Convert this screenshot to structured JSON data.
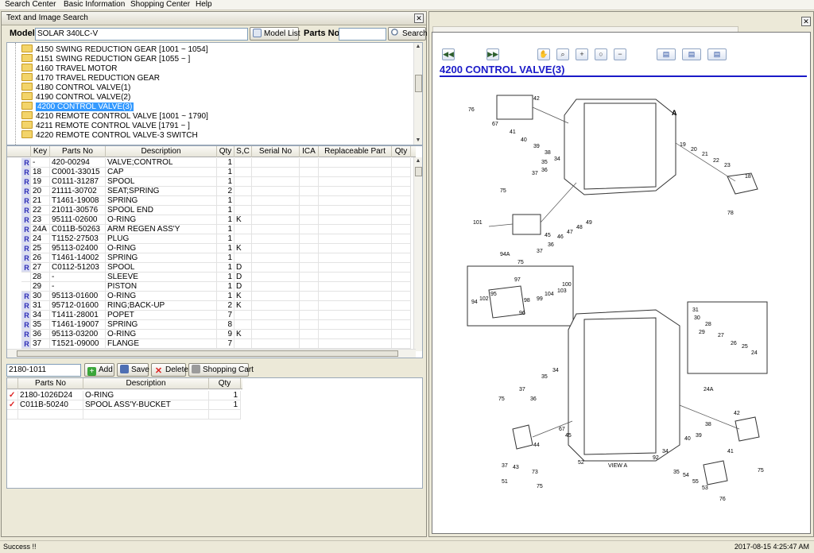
{
  "menu": [
    "Search Center",
    "Basic Information",
    "Shopping Center",
    "Help"
  ],
  "panel_title": "Text and Image Search",
  "model_label": "Model",
  "model_value": "SOLAR 340LC-V",
  "model_list_btn": "Model List",
  "parts_no_label": "Parts No",
  "parts_no_value": "",
  "search_btn": "Search",
  "tree": [
    {
      "label": "4150 SWING REDUCTION GEAR  [1001 ~ 1054]",
      "selected": false
    },
    {
      "label": "4151 SWING REDUCTION GEAR  [1055 ~ ]",
      "selected": false
    },
    {
      "label": "4160 TRAVEL MOTOR",
      "selected": false
    },
    {
      "label": "4170 TRAVEL REDUCTION GEAR",
      "selected": false
    },
    {
      "label": "4180 CONTROL VALVE(1)",
      "selected": false
    },
    {
      "label": "4190 CONTROL VALVE(2)",
      "selected": false
    },
    {
      "label": "4200 CONTROL VALVE(3)",
      "selected": true
    },
    {
      "label": "4210 REMOTE CONTROL VALVE  [1001 ~ 1790]",
      "selected": false
    },
    {
      "label": "4211 REMOTE CONTROL VALVE  [1791 ~ ]",
      "selected": false
    },
    {
      "label": "4220 REMOTE CONTROL VALVE-3 SWITCH",
      "selected": false
    }
  ],
  "grid_headers": [
    "Key",
    "Parts No",
    "Description",
    "Qty",
    "S,C",
    "Serial No",
    "ICA",
    "Replaceable Part",
    "Qty"
  ],
  "grid_rows": [
    {
      "r": "R",
      "key": "-",
      "pno": "420-00294",
      "desc": "VALVE;CONTROL",
      "qty": "1",
      "sc": ""
    },
    {
      "r": "R",
      "key": "18",
      "pno": "C0001-33015",
      "desc": "CAP",
      "qty": "1",
      "sc": ""
    },
    {
      "r": "R",
      "key": "19",
      "pno": "C0111-31287",
      "desc": "SPOOL",
      "qty": "1",
      "sc": ""
    },
    {
      "r": "R",
      "key": "20",
      "pno": "21111-30702",
      "desc": "SEAT;SPRING",
      "qty": "2",
      "sc": ""
    },
    {
      "r": "R",
      "key": "21",
      "pno": "T1461-19008",
      "desc": "SPRING",
      "qty": "1",
      "sc": ""
    },
    {
      "r": "R",
      "key": "22",
      "pno": "21011-30576",
      "desc": "SPOOL END",
      "qty": "1",
      "sc": ""
    },
    {
      "r": "R",
      "key": "23",
      "pno": "95111-02600",
      "desc": "O-RING",
      "qty": "1",
      "sc": "K"
    },
    {
      "r": "R",
      "key": "24A",
      "pno": "C011B-50263",
      "desc": "ARM REGEN ASS'Y",
      "qty": "1",
      "sc": ""
    },
    {
      "r": "R",
      "key": "24",
      "pno": "T1152-27503",
      "desc": "PLUG",
      "qty": "1",
      "sc": ""
    },
    {
      "r": "R",
      "key": "25",
      "pno": "95113-02400",
      "desc": "O-RING",
      "qty": "1",
      "sc": "K"
    },
    {
      "r": "R",
      "key": "26",
      "pno": "T1461-14002",
      "desc": "SPRING",
      "qty": "1",
      "sc": ""
    },
    {
      "r": "R",
      "key": "27",
      "pno": "C0112-51203",
      "desc": "SPOOL",
      "qty": "1",
      "sc": "D"
    },
    {
      "r": "",
      "key": "28",
      "pno": "-",
      "desc": "SLEEVE",
      "qty": "1",
      "sc": "D"
    },
    {
      "r": "",
      "key": "29",
      "pno": "-",
      "desc": "PISTON",
      "qty": "1",
      "sc": "D"
    },
    {
      "r": "R",
      "key": "30",
      "pno": "95113-01600",
      "desc": "O-RING",
      "qty": "1",
      "sc": "K"
    },
    {
      "r": "R",
      "key": "31",
      "pno": "95712-01600",
      "desc": "RING;BACK-UP",
      "qty": "2",
      "sc": "K"
    },
    {
      "r": "R",
      "key": "34",
      "pno": "T1411-28001",
      "desc": "POPET",
      "qty": "7",
      "sc": ""
    },
    {
      "r": "R",
      "key": "35",
      "pno": "T1461-19007",
      "desc": "SPRING",
      "qty": "8",
      "sc": ""
    },
    {
      "r": "R",
      "key": "36",
      "pno": "95113-03200",
      "desc": "O-RING",
      "qty": "9",
      "sc": "K"
    },
    {
      "r": "R",
      "key": "37",
      "pno": "T1521-09000",
      "desc": "FLANGE",
      "qty": "7",
      "sc": ""
    }
  ],
  "cart_input": "2180-1011",
  "add_btn": "Add",
  "save_btn": "Save",
  "delete_btn": "Delete",
  "shopping_cart_btn": "Shopping Cart",
  "cart_headers": [
    "Parts No",
    "Description",
    "Qty"
  ],
  "cart_rows": [
    {
      "pno": "2180-1026D24",
      "desc": "O-RING",
      "qty": "1"
    },
    {
      "pno": "C011B-50240",
      "desc": "SPOOL ASS'Y-BUCKET",
      "qty": "1"
    }
  ],
  "drawing_title": "4200 CONTROL VALVE(3)",
  "view_label": "VIEW  A",
  "arrow_label": "A",
  "callouts": [
    "76",
    "67",
    "42",
    "41",
    "40",
    "39",
    "38",
    "19",
    "20",
    "21",
    "22",
    "23",
    "18",
    "78",
    "37",
    "36",
    "35",
    "34",
    "75",
    "49",
    "48",
    "47",
    "46",
    "45",
    "101",
    "94A",
    "75",
    "37",
    "36",
    "97",
    "100",
    "95",
    "103",
    "102",
    "104",
    "99",
    "98",
    "94",
    "96",
    "31",
    "30",
    "28",
    "27",
    "26",
    "25",
    "24",
    "29",
    "24A",
    "34",
    "35",
    "37",
    "75",
    "36",
    "42",
    "38",
    "39",
    "40",
    "41",
    "67",
    "45",
    "44",
    "43",
    "73",
    "75",
    "37",
    "92",
    "34",
    "35",
    "54",
    "55",
    "53",
    "52",
    "51",
    "75",
    "76",
    "75"
  ],
  "status_left": "Success !!",
  "status_right": "2017-08-15 4:25:47 AM"
}
